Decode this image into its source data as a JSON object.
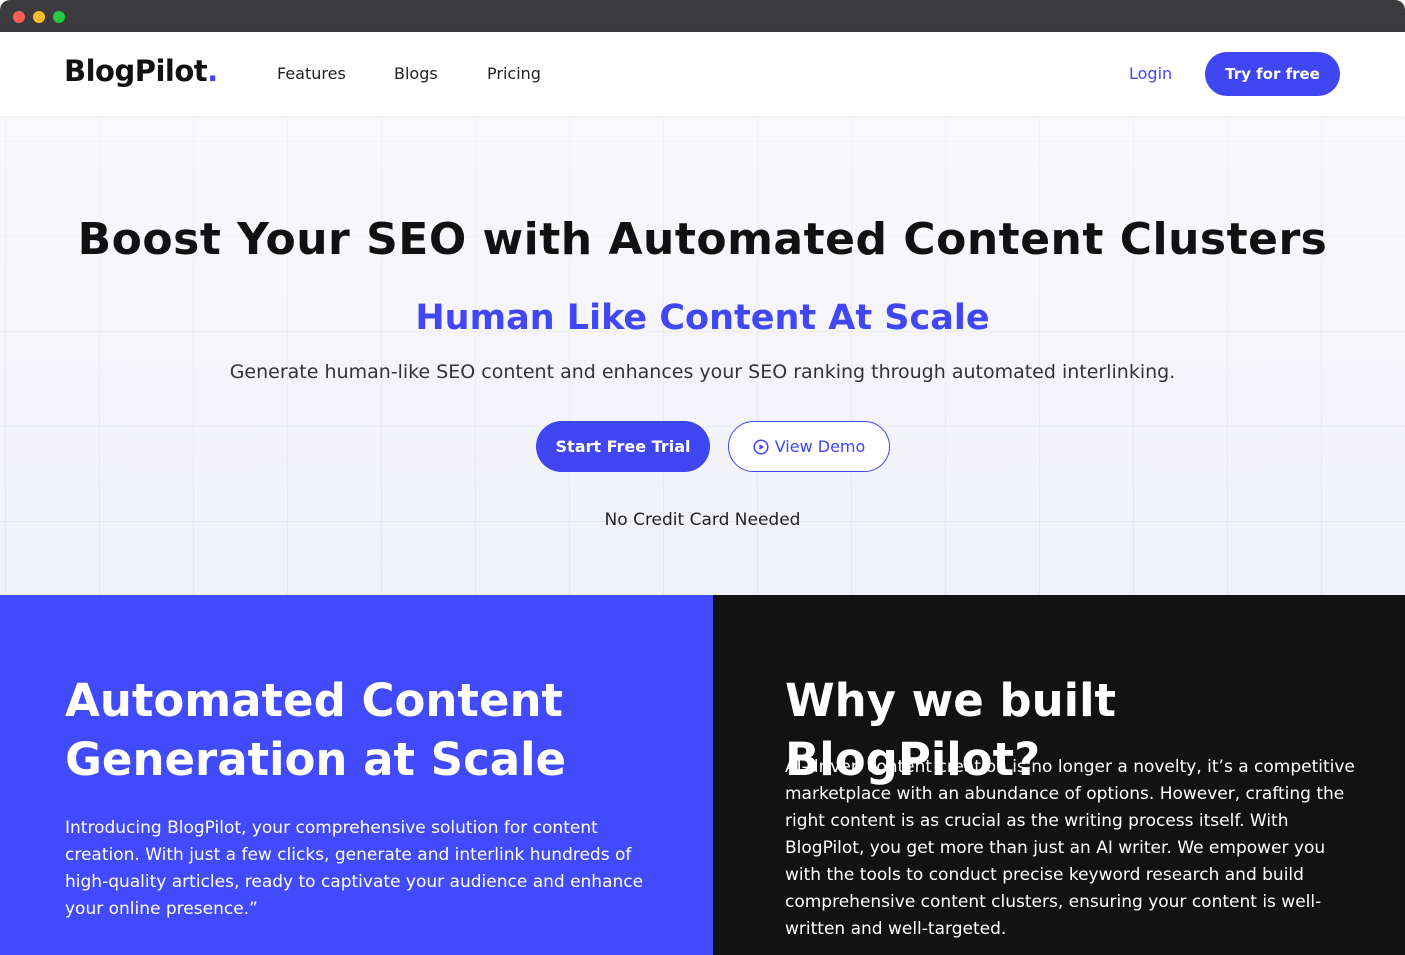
{
  "nav": {
    "logo_text": "BlogPilot",
    "logo_dot": ".",
    "links": [
      {
        "label": "Features"
      },
      {
        "label": "Blogs"
      },
      {
        "label": "Pricing"
      }
    ],
    "login_label": "Login",
    "cta_label": "Try for free"
  },
  "hero": {
    "title": "Boost Your SEO with Automated Content Clusters",
    "subtitle": "Human Like Content At Scale",
    "description": "Generate human-like SEO content and enhances your SEO ranking through automated interlinking.",
    "primary_button": "Start Free Trial",
    "secondary_button": "View Demo",
    "secondary_icon": "play-circle-icon",
    "note": "No Credit Card Needed"
  },
  "features": {
    "left": {
      "title": "Automated Content Generation at Scale",
      "text": "Introducing BlogPilot, your comprehensive solution for content creation. With just a few clicks, generate and interlink hundreds of high-quality articles, ready to captivate your audience and enhance your online presence.”"
    },
    "right": {
      "title": "Why we built BlogPilot?",
      "text": "AI-driven content creation is no longer a novelty, it’s a competitive marketplace with an abundance of options. However, crafting the right content is as crucial as the writing process itself. With BlogPilot, you get more than just an AI writer. We empower you with the tools to conduct precise keyword research and build comprehensive content clusters, ensuring your content is well-written and well-targeted."
    }
  },
  "colors": {
    "accent": "#4147f5",
    "left_panel": "#424bfb",
    "right_panel": "#121212"
  }
}
